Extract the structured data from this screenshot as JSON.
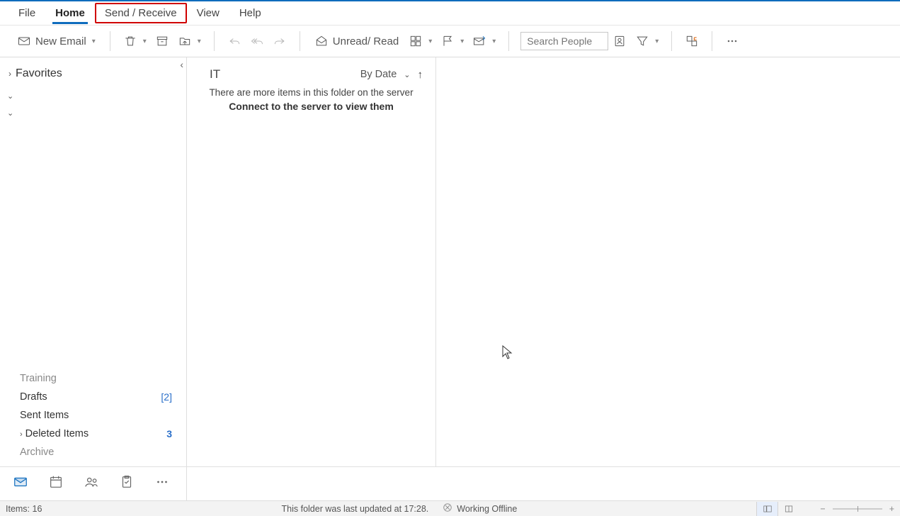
{
  "ribbon": {
    "tabs": {
      "file": "File",
      "home": "Home",
      "send_receive": "Send / Receive",
      "view": "View",
      "help": "Help"
    }
  },
  "toolbar": {
    "new_email": "New Email",
    "unread_read": "Unread/ Read",
    "search_placeholder": "Search People"
  },
  "nav": {
    "favorites": "Favorites",
    "folders": {
      "training": "Training",
      "drafts": "Drafts",
      "drafts_count": "[2]",
      "sent": "Sent Items",
      "deleted": "Deleted Items",
      "deleted_count": "3",
      "archive": "Archive"
    }
  },
  "list": {
    "title": "IT",
    "sort": "By Date",
    "server_line1": "There are more items in this folder on the server",
    "server_line2": "Connect to the server to view them"
  },
  "status": {
    "items": "Items: 16",
    "updated": "This folder was last updated at 17:28.",
    "offline": "Working Offline"
  }
}
